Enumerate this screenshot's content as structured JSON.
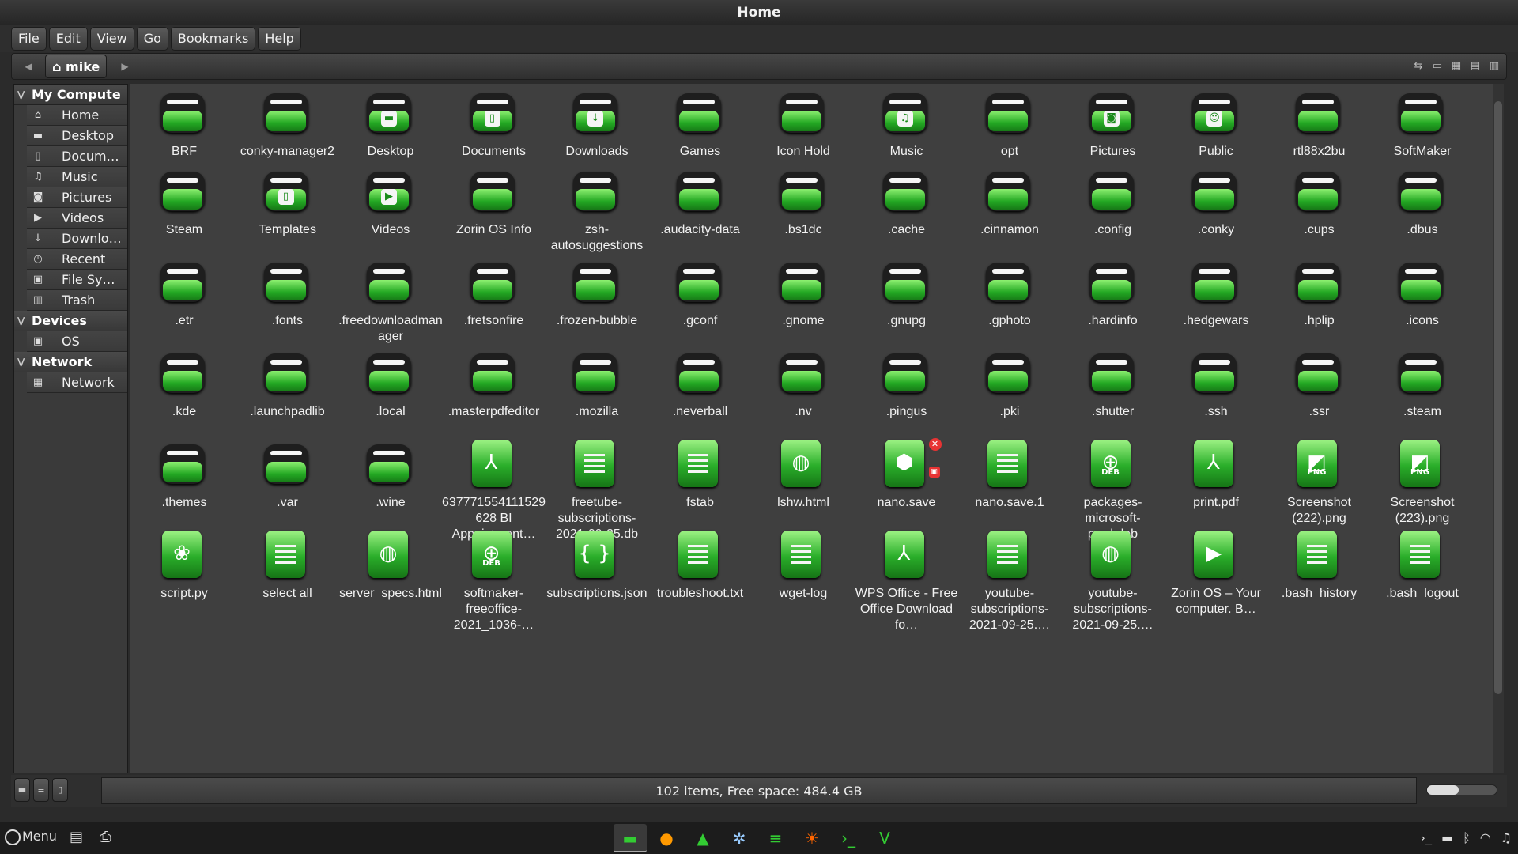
{
  "window": {
    "title": "Home"
  },
  "menubar": [
    "File",
    "Edit",
    "View",
    "Go",
    "Bookmarks",
    "Help"
  ],
  "toolbar": {
    "back": "◀",
    "forward": "▶",
    "breadcrumb": "mike"
  },
  "sidebar": {
    "sections": [
      {
        "title": "My Compute",
        "items": [
          {
            "label": "Home",
            "icon": "⌂"
          },
          {
            "label": "Desktop",
            "icon": "▬"
          },
          {
            "label": "Docum…",
            "icon": "▯"
          },
          {
            "label": "Music",
            "icon": "♫"
          },
          {
            "label": "Pictures",
            "icon": "◙"
          },
          {
            "label": "Videos",
            "icon": "▶"
          },
          {
            "label": "Downlo…",
            "icon": "↓"
          },
          {
            "label": "Recent",
            "icon": "◷"
          },
          {
            "label": "File Sy…",
            "icon": "▣"
          },
          {
            "label": "Trash",
            "icon": "▥"
          }
        ]
      },
      {
        "title": "Devices",
        "items": [
          {
            "label": "OS",
            "icon": "▣"
          }
        ]
      },
      {
        "title": "Network",
        "items": [
          {
            "label": "Network",
            "icon": "▦"
          }
        ]
      }
    ]
  },
  "files": [
    {
      "name": "BRF",
      "type": "folder"
    },
    {
      "name": "conky-manager2",
      "type": "folder"
    },
    {
      "name": "Desktop",
      "type": "folder",
      "emblem": "▬"
    },
    {
      "name": "Documents",
      "type": "folder",
      "emblem": "▯"
    },
    {
      "name": "Downloads",
      "type": "folder",
      "emblem": "↓"
    },
    {
      "name": "Games",
      "type": "folder"
    },
    {
      "name": "Icon Hold",
      "type": "folder"
    },
    {
      "name": "Music",
      "type": "folder",
      "emblem": "♫"
    },
    {
      "name": "opt",
      "type": "folder"
    },
    {
      "name": "Pictures",
      "type": "folder",
      "emblem": "◙"
    },
    {
      "name": "Public",
      "type": "folder",
      "emblem": "☺"
    },
    {
      "name": "rtl88x2bu",
      "type": "folder"
    },
    {
      "name": "SoftMaker",
      "type": "folder"
    },
    {
      "name": "Steam",
      "type": "folder"
    },
    {
      "name": "Templates",
      "type": "folder",
      "emblem": "▯"
    },
    {
      "name": "Videos",
      "type": "folder",
      "emblem": "▶"
    },
    {
      "name": "Zorin OS Info",
      "type": "folder"
    },
    {
      "name": "zsh-autosuggestions",
      "type": "folder"
    },
    {
      "name": ".audacity-data",
      "type": "folder"
    },
    {
      "name": ".bs1dc",
      "type": "folder"
    },
    {
      "name": ".cache",
      "type": "folder"
    },
    {
      "name": ".cinnamon",
      "type": "folder"
    },
    {
      "name": ".config",
      "type": "folder"
    },
    {
      "name": ".conky",
      "type": "folder"
    },
    {
      "name": ".cups",
      "type": "folder"
    },
    {
      "name": ".dbus",
      "type": "folder"
    },
    {
      "name": ".etr",
      "type": "folder"
    },
    {
      "name": ".fonts",
      "type": "folder"
    },
    {
      "name": ".freedownloadmanager",
      "type": "folder"
    },
    {
      "name": ".fretsonfire",
      "type": "folder"
    },
    {
      "name": ".frozen-bubble",
      "type": "folder"
    },
    {
      "name": ".gconf",
      "type": "folder"
    },
    {
      "name": ".gnome",
      "type": "folder"
    },
    {
      "name": ".gnupg",
      "type": "folder"
    },
    {
      "name": ".gphoto",
      "type": "folder"
    },
    {
      "name": ".hardinfo",
      "type": "folder"
    },
    {
      "name": ".hedgewars",
      "type": "folder"
    },
    {
      "name": ".hplip",
      "type": "folder"
    },
    {
      "name": ".icons",
      "type": "folder"
    },
    {
      "name": ".kde",
      "type": "folder"
    },
    {
      "name": ".launchpadlib",
      "type": "folder"
    },
    {
      "name": ".local",
      "type": "folder"
    },
    {
      "name": ".masterpdfeditor",
      "type": "folder"
    },
    {
      "name": ".mozilla",
      "type": "folder"
    },
    {
      "name": ".neverball",
      "type": "folder"
    },
    {
      "name": ".nv",
      "type": "folder"
    },
    {
      "name": ".pingus",
      "type": "folder"
    },
    {
      "name": ".pki",
      "type": "folder"
    },
    {
      "name": ".shutter",
      "type": "folder"
    },
    {
      "name": ".ssh",
      "type": "folder"
    },
    {
      "name": ".ssr",
      "type": "folder"
    },
    {
      "name": ".steam",
      "type": "folder"
    },
    {
      "name": ".themes",
      "type": "folder"
    },
    {
      "name": ".var",
      "type": "folder"
    },
    {
      "name": ".wine",
      "type": "folder"
    },
    {
      "name": "637771554111529628 BI Appointment…",
      "type": "pdf"
    },
    {
      "name": "freetube-subscriptions-2021-09-25.db",
      "type": "text"
    },
    {
      "name": "fstab",
      "type": "text"
    },
    {
      "name": "lshw.html",
      "type": "html"
    },
    {
      "name": "nano.save",
      "type": "package-broken"
    },
    {
      "name": "nano.save.1",
      "type": "text"
    },
    {
      "name": "packages-microsoft-prod.deb",
      "type": "deb"
    },
    {
      "name": "print.pdf",
      "type": "pdf"
    },
    {
      "name": "Screenshot (222).png",
      "type": "png"
    },
    {
      "name": "Screenshot (223).png",
      "type": "png"
    },
    {
      "name": "script.py",
      "type": "python"
    },
    {
      "name": "select all",
      "type": "text"
    },
    {
      "name": "server_specs.html",
      "type": "html"
    },
    {
      "name": "softmaker-freeoffice-2021_1036-…",
      "type": "deb"
    },
    {
      "name": "subscriptions.json",
      "type": "json"
    },
    {
      "name": "troubleshoot.txt",
      "type": "text"
    },
    {
      "name": "wget-log",
      "type": "text"
    },
    {
      "name": "WPS Office - Free Office Download fo…",
      "type": "pdf"
    },
    {
      "name": "youtube-subscriptions-2021-09-25.…",
      "type": "sheet"
    },
    {
      "name": "youtube-subscriptions-2021-09-25.…",
      "type": "html"
    },
    {
      "name": "Zorin OS – Your computer. B…",
      "type": "video"
    },
    {
      "name": ".bash_history",
      "type": "text"
    },
    {
      "name": ".bash_logout",
      "type": "text"
    }
  ],
  "status": {
    "text": "102 items, Free space: 484.4 GB",
    "zoom_level": 0.45
  },
  "panel": {
    "menu_label": "Menu"
  }
}
